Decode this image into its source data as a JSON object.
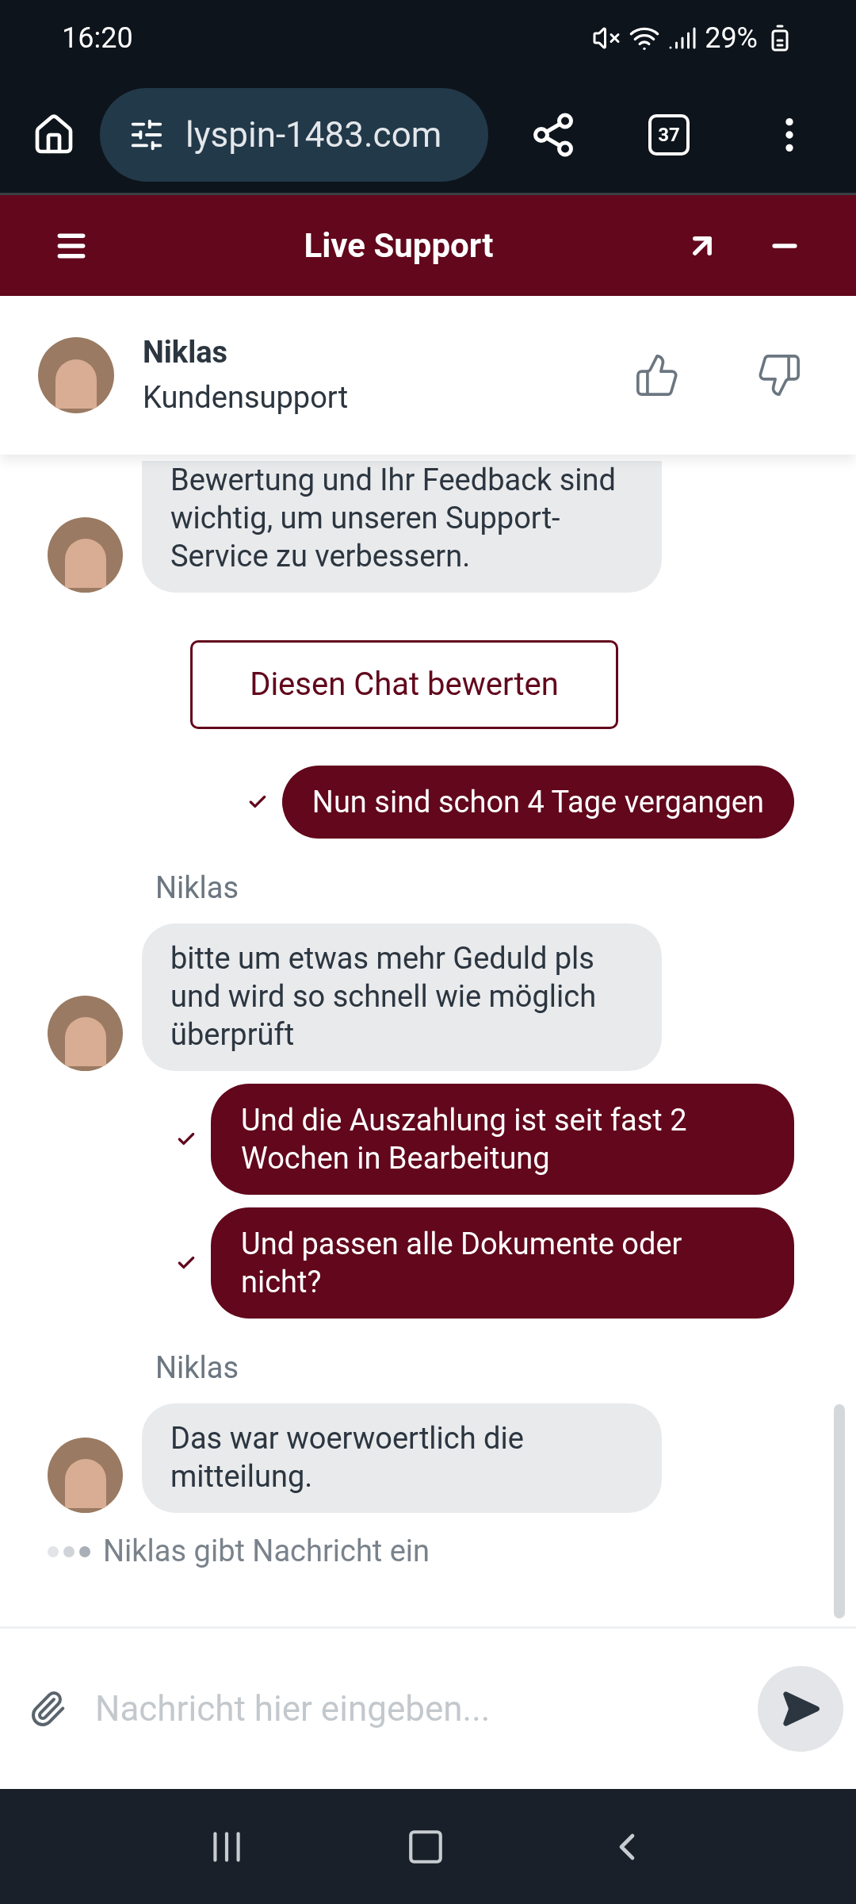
{
  "status_bar": {
    "time": "16:20",
    "battery": "29%"
  },
  "browser": {
    "url": "lyspin-1483.com",
    "tab_count": "37"
  },
  "header": {
    "title": "Live Support"
  },
  "agent": {
    "name": "Niklas",
    "role": "Kundensupport"
  },
  "messages": [
    {
      "kind": "agent",
      "text": "Bewertung und Ihr Feedback sind wichtig, um unseren Support-Service zu verbessern.",
      "cut_top": true
    },
    {
      "kind": "button",
      "text": "Diesen Chat bewerten"
    },
    {
      "kind": "user",
      "text": "Nun sind schon 4 Tage vergangen",
      "delivered": true
    },
    {
      "kind": "name",
      "text": "Niklas"
    },
    {
      "kind": "agent",
      "text": "bitte um etwas mehr Geduld pls und wird so schnell wie möglich überprüft",
      "cut_top": false
    },
    {
      "kind": "user",
      "text": "Und die Auszahlung ist seit fast 2 Wochen in Bearbeitung",
      "delivered": true
    },
    {
      "kind": "user",
      "text": "Und passen alle Dokumente oder nicht?",
      "delivered": true
    },
    {
      "kind": "name",
      "text": "Niklas"
    },
    {
      "kind": "agent",
      "text": "Das war woerwoertlich die mitteilung.",
      "cut_top": false
    }
  ],
  "typing": "Niklas gibt Nachricht ein",
  "composer": {
    "placeholder": "Nachricht hier eingeben..."
  }
}
